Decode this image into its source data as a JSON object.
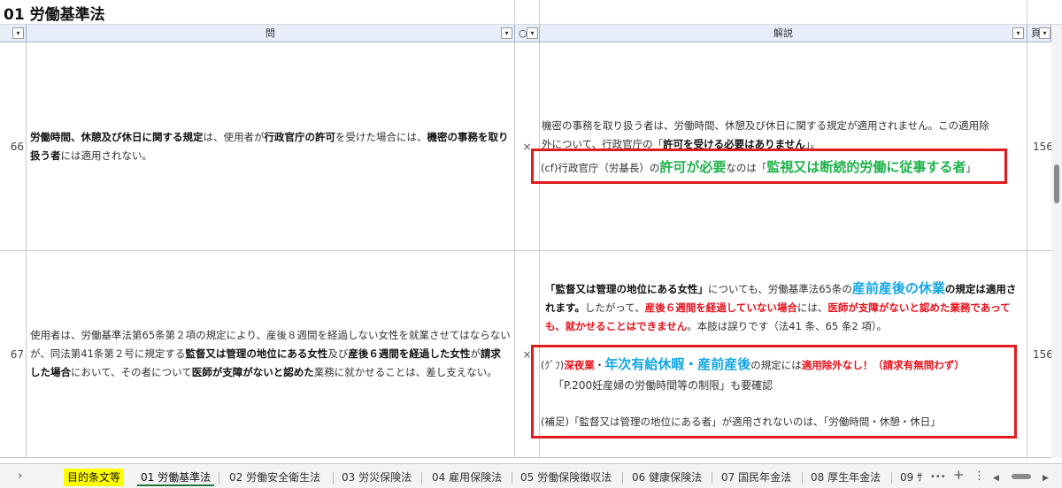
{
  "sheet_title": "01 労働基準法",
  "headers": {
    "question": "問",
    "mark": "○",
    "explanation": "解説",
    "page": "頁"
  },
  "rows": [
    {
      "number": "66",
      "q_parts": [
        "労働時間、休憩及び休日に関する規定",
        "は、使用者が",
        "行政官庁の許可",
        "を受けた場合には、",
        "機密の事務を取り扱う者",
        "には適用されない。"
      ],
      "mark": "×",
      "ans_line1": "機密の事務を取り扱う者は、労働時間、休憩及び休日に関する規定が適用されません。この適用除",
      "ans_line2a": "外について、行政官庁の「",
      "ans_line2b": "許可を受ける必要はありません",
      "ans_line2c": "」。",
      "box_a": "(cf)行政官庁（労基長）の",
      "box_b": "許可が必要",
      "box_c": "なのは「",
      "box_d": "監視又は断続的労働に従事する者",
      "box_e": "」",
      "page": "156"
    },
    {
      "number": "67",
      "q_parts": [
        "使用者は、労働基準法第65条第２項の規定により、産後８週間を経過しない女性を就業させてはならないが、同法第41条第２号に規定する",
        "監督又は管理の地位にある女性",
        "及び",
        "産後６週間を経過した女性",
        "が",
        "請求した場合",
        "において、その者について",
        "医師が支障がないと認めた",
        "業務に就かせることは、差し支えない。"
      ],
      "mark": "×",
      "ans_a": "「監督又は管理の地位にある女性」",
      "ans_b": "についても、労働基準法65条の",
      "ans_c": "産前産後の休業",
      "ans_d": "の規定は適",
      "ans_e": "用されます。",
      "ans_f": "したがって、",
      "ans_g": "産後６週間を経過していない場合",
      "ans_h": "には、",
      "ans_i": "医師が支障がないと認めた業務",
      "ans_j": "であっても、就かせることはできません",
      "ans_k": "。本肢は誤りです（法41 条、65 条2 項）。",
      "box_a": "(ｸﾞﾌ)",
      "box_b": "深夜業",
      "box_c": "・",
      "box_d": "年次有給休暇・産前産後",
      "box_e": "の規定には",
      "box_f": "適用除外なし！（請求有無問わず）",
      "box_g": "「P.200妊産婦の労働時間等の制限」も要確認",
      "box_h": "(補足)「監督又は管理の地位にある者」が適用されないのは、「労働時間・休憩・休日」",
      "page": "156"
    }
  ],
  "tabs": [
    {
      "label": "目的条文等",
      "style": "yellow"
    },
    {
      "label": "01 労働基準法",
      "style": "active"
    },
    {
      "label": "02 労働安全衛生法",
      "style": ""
    },
    {
      "label": "03 労災保険法",
      "style": ""
    },
    {
      "label": "04 雇用保険法",
      "style": ""
    },
    {
      "label": "05 労働保険徴収法",
      "style": ""
    },
    {
      "label": "06 健康保険法",
      "style": ""
    },
    {
      "label": "07 国民年金法",
      "style": ""
    },
    {
      "label": "08 厚生年金法",
      "style": ""
    },
    {
      "label": "09 ｻ",
      "style": ""
    }
  ],
  "tab_tools": {
    "nav": "›",
    "more": "•••",
    "add": "+",
    "menu": "⋮",
    "left": "◀",
    "right": "▶"
  },
  "colors": {
    "header_bg": "#e7eef9",
    "emphasis_red": "#e8111b",
    "emphasis_green": "#1db34a",
    "emphasis_blue": "#13a6e6",
    "box_border": "#e21c1c",
    "active_tab": "#217346",
    "highlight_tab": "#ffff00"
  }
}
